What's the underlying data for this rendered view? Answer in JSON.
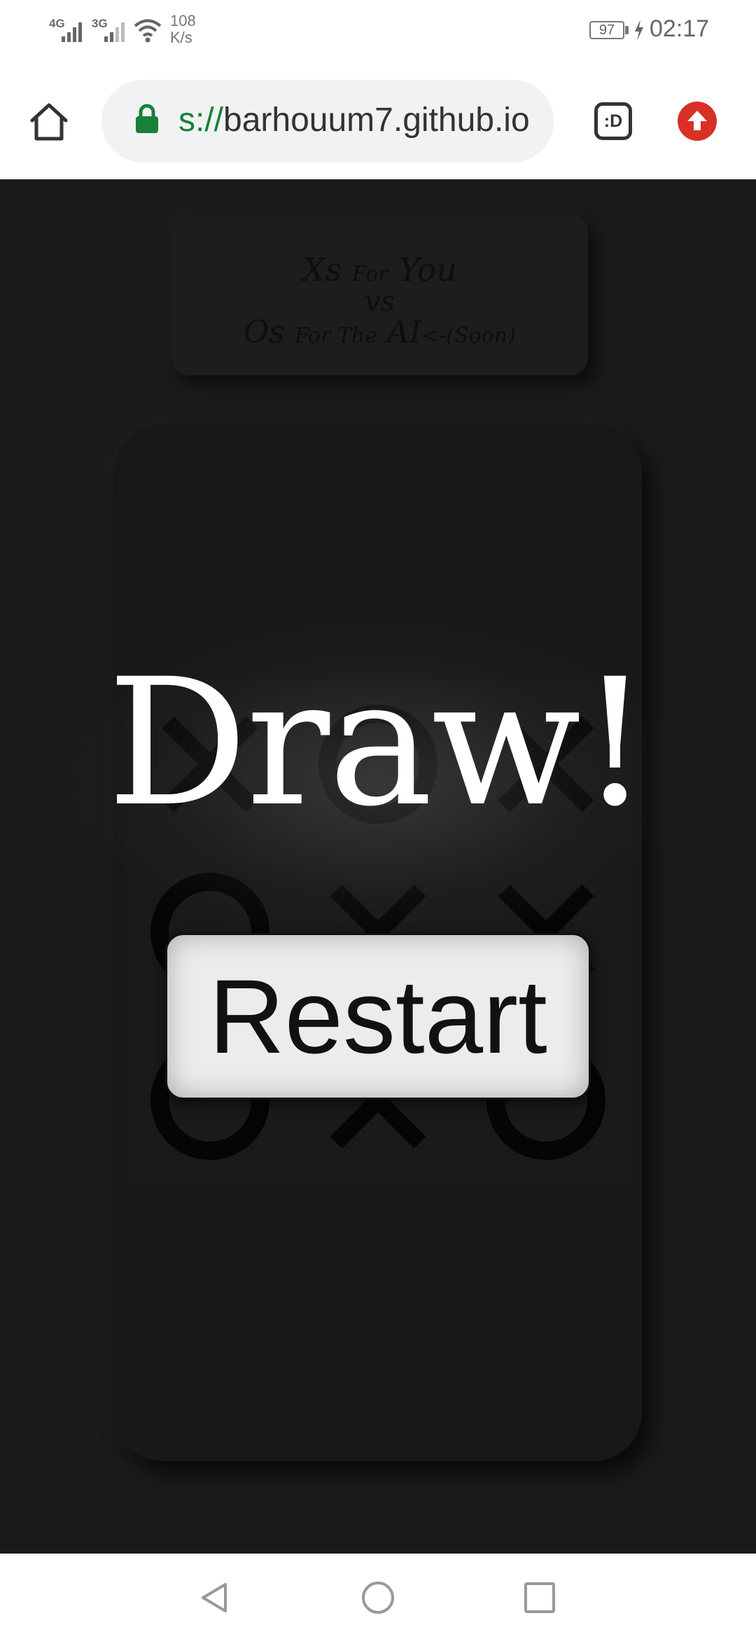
{
  "status_bar": {
    "signal1": "4G",
    "signal2": "3G",
    "net_speed_value": "108",
    "net_speed_unit": "K/s",
    "battery": "97",
    "time": "02:17"
  },
  "browser": {
    "url_scheme": "s://",
    "url_host": "barhouum7.github.io",
    "tab_switcher_label": ":D",
    "icons": [
      "home-icon",
      "lock-icon",
      "tab-switcher-icon",
      "update-icon"
    ],
    "accent_red": "#d93025",
    "lock_green": "#188038"
  },
  "page": {
    "title_line1_big1": "Xs",
    "title_line1_small": "For",
    "title_line1_big2": "You",
    "title_line2": "vs",
    "title_line3_big1": "Os",
    "title_line3_small": "For The",
    "title_line3_big2": "AI",
    "title_line3_tail": "<-(Soon)",
    "board": [
      "X",
      "O",
      "X",
      "O",
      "X",
      "X",
      "O",
      "X",
      "O"
    ],
    "result_text": "Draw!",
    "restart_label": "Restart"
  },
  "nav_bar": {
    "icons": [
      "back-icon",
      "home-circle-icon",
      "recents-icon"
    ]
  }
}
